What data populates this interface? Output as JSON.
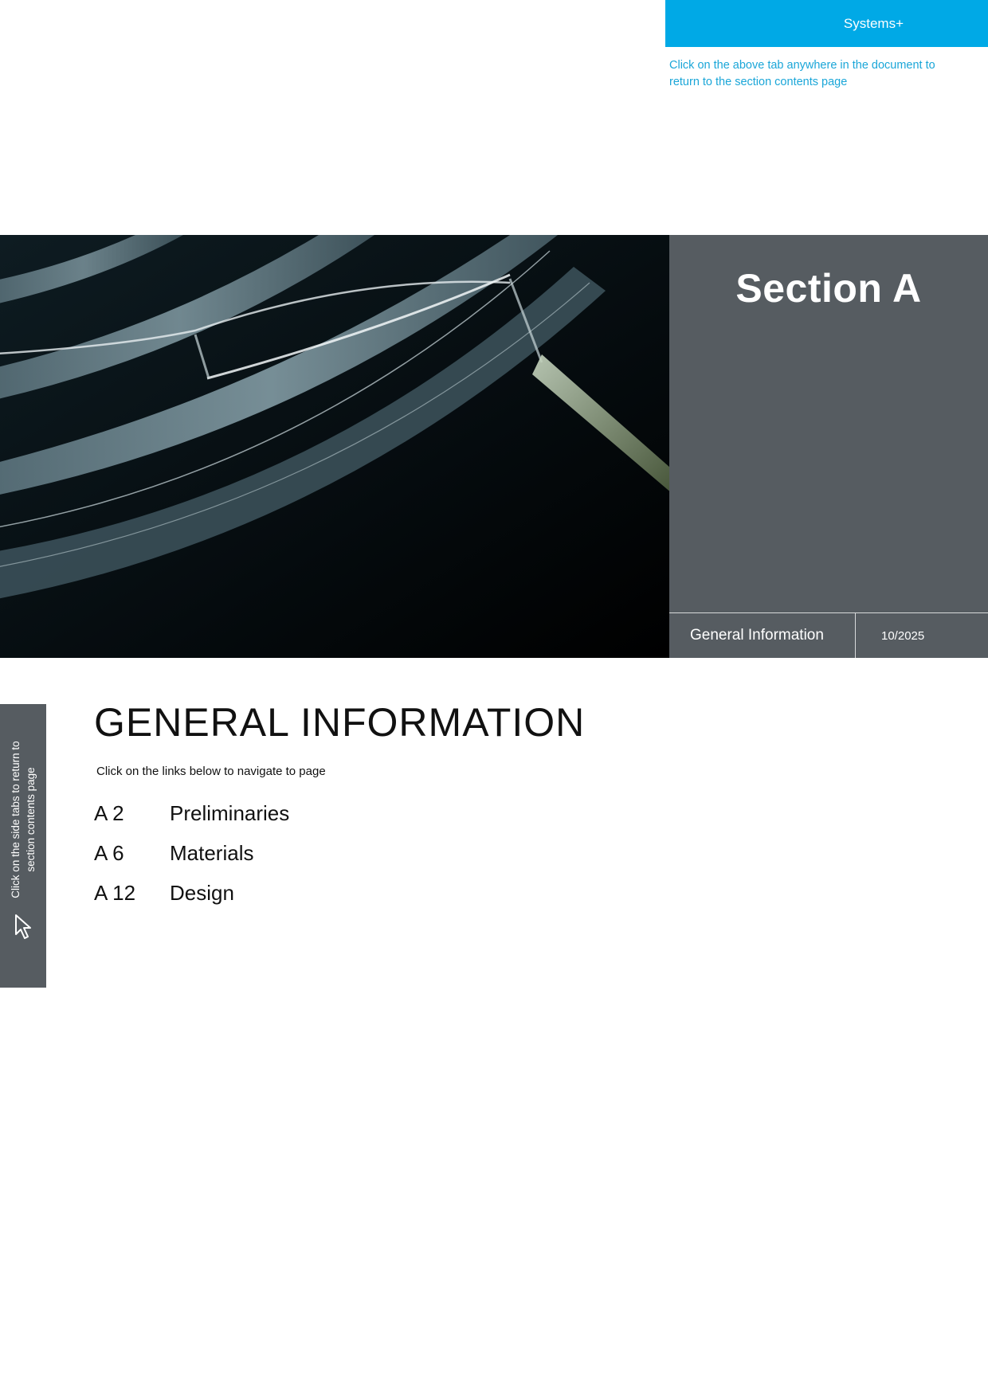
{
  "header": {
    "tab_label": "Systems+",
    "tab_note": "Click on the above tab anywhere in the document to return to the section contents page"
  },
  "section_panel": {
    "title": "Section A",
    "footer_label": "General Information",
    "footer_date": "10/2025"
  },
  "side_tab": {
    "text_line1": "Click on the side tabs to return to",
    "text_line2": "section contents page",
    "icon": "cursor-arrow-icon"
  },
  "main": {
    "heading": "GENERAL INFORMATION",
    "hint": "Click on the links below to navigate to page",
    "toc": [
      {
        "page": "A 2",
        "label": "Preliminaries"
      },
      {
        "page": "A 6",
        "label": "Materials"
      },
      {
        "page": "A 12",
        "label": "Design"
      }
    ]
  },
  "colors": {
    "accent_blue": "#00a9e6",
    "panel_grey": "#565c61"
  }
}
